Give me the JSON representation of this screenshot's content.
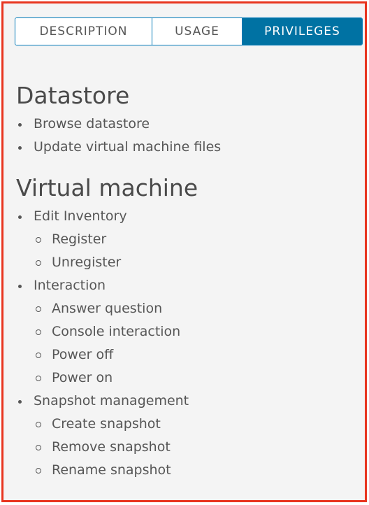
{
  "tabs": [
    {
      "label": "DESCRIPTION",
      "active": false
    },
    {
      "label": "USAGE",
      "active": false
    },
    {
      "label": "PRIVILEGES",
      "active": true
    }
  ],
  "sections": [
    {
      "title": "Datastore",
      "items": [
        {
          "label": "Browse datastore"
        },
        {
          "label": "Update virtual machine files"
        }
      ]
    },
    {
      "title": "Virtual machine",
      "items": [
        {
          "label": "Edit Inventory",
          "children": [
            "Register",
            "Unregister"
          ]
        },
        {
          "label": "Interaction",
          "children": [
            "Answer question",
            "Console interaction",
            "Power off",
            "Power on"
          ]
        },
        {
          "label": "Snapshot management",
          "children": [
            "Create snapshot",
            "Remove snapshot",
            "Rename snapshot"
          ]
        }
      ]
    }
  ],
  "colors": {
    "accent": "#0072a3",
    "highlight_border": "#e8351f",
    "text": "#565656"
  }
}
